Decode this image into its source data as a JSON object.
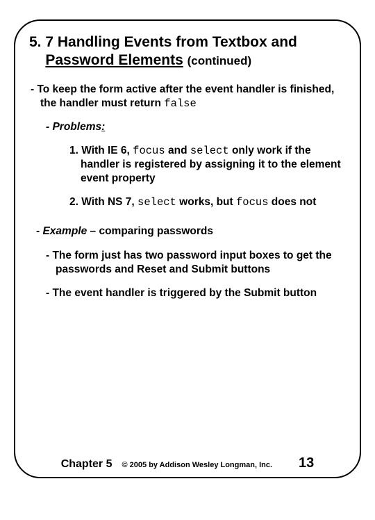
{
  "title": {
    "section_number": "5. 7",
    "main": "Handling Events from Textbox and ",
    "underlined": "Password Elements",
    "continued": "(continued)"
  },
  "bullets": {
    "keep_active_pre": "- To keep the form active after the event handler is finished, the handler must return ",
    "keep_active_code": "false",
    "problems_label": "- Problems",
    "colon": ":",
    "p1_pre": "1. With IE 6, ",
    "p1_code1": "focus",
    "p1_mid1": " and ",
    "p1_code2": "select",
    "p1_post": " only work if the handler is registered by assigning it to the element event property",
    "p2_pre": "2. With NS 7, ",
    "p2_code1": "select",
    "p2_mid": " works, but ",
    "p2_code2": "focus",
    "p2_post": " does not",
    "example_dash": "- ",
    "example_word": "Example",
    "example_rest": " – comparing passwords",
    "form_desc": "- The form just has two password input boxes to get the passwords and Reset and Submit buttons",
    "trigger_desc": "- The event handler is triggered by the Submit button"
  },
  "footer": {
    "chapter": "Chapter 5",
    "copyright": "© 2005 by Addison Wesley Longman, Inc.",
    "page": "13"
  }
}
